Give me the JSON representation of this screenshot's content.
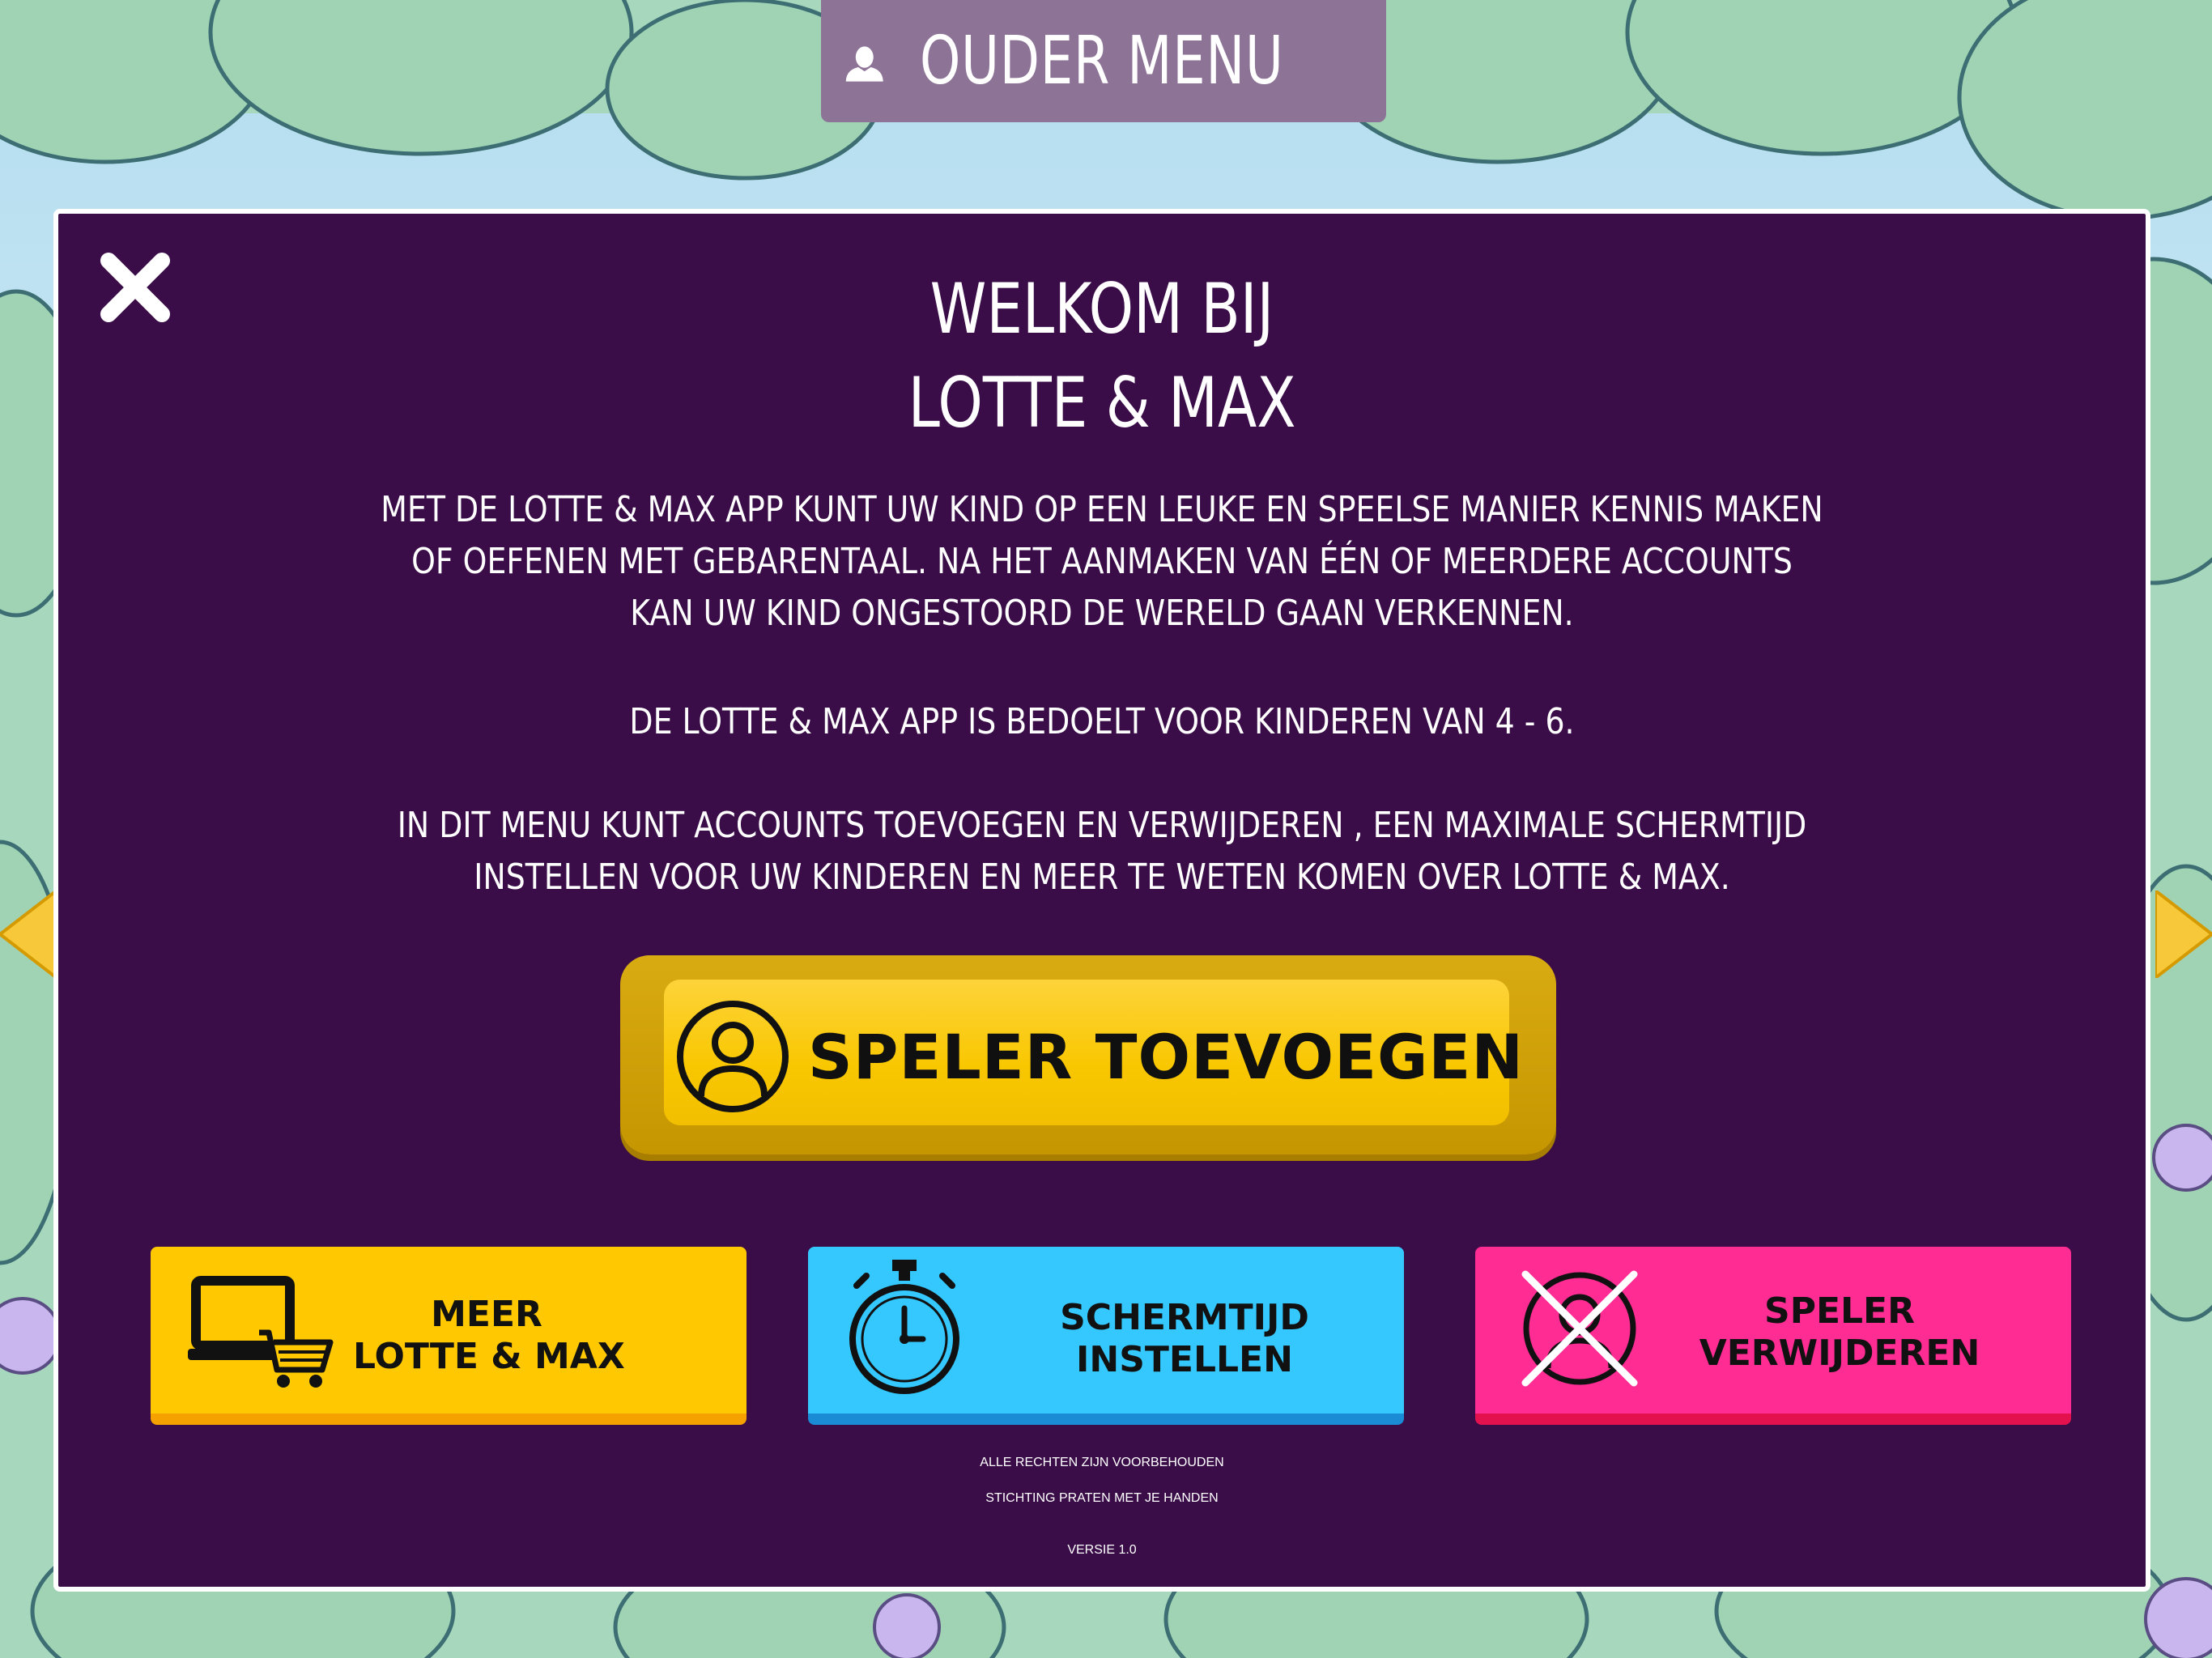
{
  "header": {
    "title": "OUDER MENU"
  },
  "welcome": {
    "title_line1": "WELKOM BIJ",
    "title_line2": "LOTTE & MAX",
    "paragraph1": [
      "MET DE LOTTE & MAX APP KUNT UW KIND OP EEN LEUKE EN SPEELSE MANIER KENNIS MAKEN",
      "OF OEFENEN MET GEBARENTAAL. NA HET AANMAKEN VAN ÉÉN OF MEERDERE ACCOUNTS",
      "KAN UW KIND ONGESTOORD DE WERELD GAAN VERKENNEN."
    ],
    "paragraph2": "DE LOTTE & MAX APP IS BEDOELT VOOR KINDEREN VAN 4 - 6.",
    "paragraph3": [
      "IN DIT MENU KUNT ACCOUNTS TOEVOEGEN EN VERWIJDEREN ,  EEN MAXIMALE SCHERMTIJD",
      "INSTELLEN VOOR UW KINDEREN EN MEER TE WETEN KOMEN OVER LOTTE & MAX."
    ]
  },
  "buttons": {
    "add_player": "SPELER TOEVOEGEN",
    "more_line1": "MEER",
    "more_line2": "LOTTE & MAX",
    "screentime_line1": "SCHERMTIJD",
    "screentime_line2": "INSTELLEN",
    "remove_line1": "SPELER",
    "remove_line2": "VERWIJDEREN"
  },
  "footer": {
    "rights": "ALLE RECHTEN ZIJN VOORBEHOUDEN",
    "foundation": "STICHTING PRATEN MET JE HANDEN",
    "version": "VERSIE 1.0"
  },
  "icons": {
    "header": "user-silhouette-icon",
    "close": "close-icon",
    "add_player": "user-circle-icon",
    "more": "laptop-cart-icon",
    "screentime": "stopwatch-icon",
    "remove": "user-crossed-icon"
  },
  "colors": {
    "panel": "#3a0d49",
    "header_tab": "#8d7497",
    "add_button": "#f9c700",
    "more_button": "#ffc800",
    "screentime_button": "#35c8ff",
    "remove_button": "#ff2c93"
  }
}
